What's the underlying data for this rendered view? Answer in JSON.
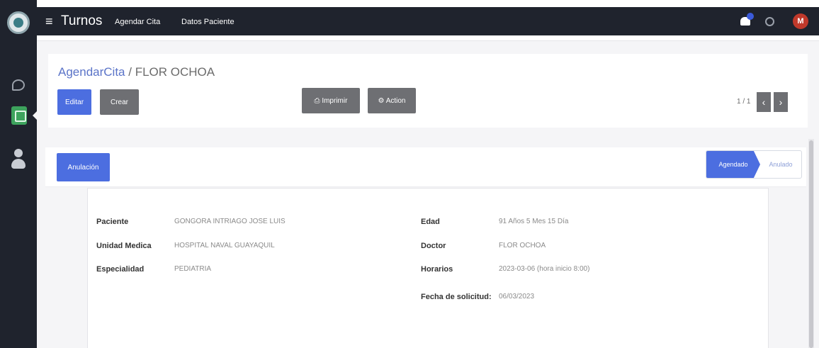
{
  "app": {
    "title": "Turnos",
    "menu_icon": "≡",
    "nav": [
      "Agendar Cita",
      "Datos Paciente"
    ],
    "avatar_initial": "M",
    "colors": {
      "primary": "#4c6ee0",
      "secondary": "#6e6f73",
      "navbar": "#1f232d",
      "avatar": "#c0392b"
    }
  },
  "breadcrumb": {
    "parent": "AgendarCita",
    "separator": " / ",
    "current": "FLOR OCHOA"
  },
  "toolbar": {
    "edit_label": "Editar",
    "create_label": "Crear",
    "print_label": "⎙ Imprimir",
    "action_label": "⚙ Action",
    "pager_value": "1 / 1",
    "pager_prev": "‹",
    "pager_next": "›"
  },
  "statusbar": {
    "anular_label": "Anulación",
    "steps": [
      {
        "label": "Agendado",
        "active": true
      },
      {
        "label": "Anulado",
        "active": false
      }
    ]
  },
  "form": {
    "left": [
      {
        "label": "Paciente",
        "value": "GONGORA INTRIAGO JOSE LUIS"
      },
      {
        "label": "Unidad Medica",
        "value": "HOSPITAL NAVAL GUAYAQUIL"
      },
      {
        "label": "Especialidad",
        "value": "PEDIATRIA"
      }
    ],
    "right": [
      {
        "label": "Edad",
        "value": "91 Años 5 Mes 15 Día"
      },
      {
        "label": "Doctor",
        "value": "FLOR OCHOA"
      },
      {
        "label": "Horarios",
        "value": "2023-03-06 (hora inicio 8:00)"
      },
      {
        "label": "Fecha de solicitud:",
        "value": "06/03/2023"
      }
    ]
  }
}
